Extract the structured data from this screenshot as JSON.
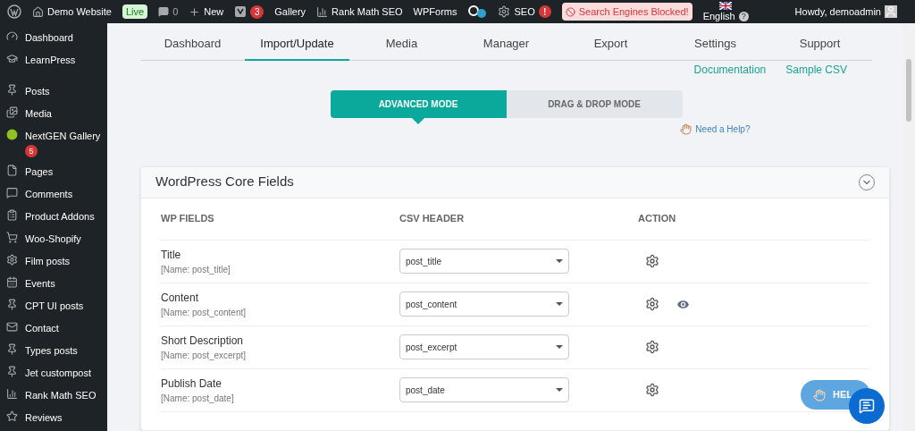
{
  "admin_bar": {
    "site": "Demo Website",
    "live": "Live",
    "comments": "0",
    "new": "New",
    "yoast_count": "3",
    "gallery": "Gallery",
    "rank_math": "Rank Math SEO",
    "wpforms": "WPForms",
    "seo": "SEO",
    "seo_alert": "!",
    "blocked": "Search Engines Blocked!",
    "language": "English",
    "language_help": "?",
    "greeting": "Howdy, demoadmin"
  },
  "sidebar": {
    "items": [
      {
        "label": "Dashboard"
      },
      {
        "label": "LearnPress"
      },
      {
        "label": "Posts"
      },
      {
        "label": "Media"
      },
      {
        "label": "NextGEN Gallery",
        "badge": "5"
      },
      {
        "label": "Pages"
      },
      {
        "label": "Comments"
      },
      {
        "label": "Product Addons"
      },
      {
        "label": "Woo-Shopify"
      },
      {
        "label": "Film posts"
      },
      {
        "label": "Events"
      },
      {
        "label": "CPT UI posts"
      },
      {
        "label": "Contact"
      },
      {
        "label": "Types posts"
      },
      {
        "label": "Jet custompost"
      },
      {
        "label": "Rank Math SEO"
      },
      {
        "label": "Reviews"
      }
    ]
  },
  "tabs": [
    {
      "label": "Dashboard",
      "selected": false
    },
    {
      "label": "Import/Update",
      "selected": true
    },
    {
      "label": "Media",
      "selected": false
    },
    {
      "label": "Manager",
      "selected": false
    },
    {
      "label": "Export",
      "selected": false
    },
    {
      "label": "Settings",
      "selected": false
    },
    {
      "label": "Support",
      "selected": false
    }
  ],
  "links": [
    "Documentation",
    "Sample CSV"
  ],
  "modes": [
    {
      "label": "ADVANCED MODE",
      "selected": true
    },
    {
      "label": "DRAG & DROP MODE",
      "selected": false
    }
  ],
  "help_link": "Need a Help?",
  "card": {
    "title": "WordPress Core Fields",
    "expanded": true,
    "columns": [
      "WP FIELDS",
      "CSV HEADER",
      "ACTION"
    ],
    "rows": [
      {
        "label": "Title",
        "name": "[Name: post_title]",
        "value": "post_title",
        "preview": false
      },
      {
        "label": "Content",
        "name": "[Name: post_content]",
        "value": "post_content",
        "preview": true
      },
      {
        "label": "Short Description",
        "name": "[Name: post_excerpt]",
        "value": "post_excerpt",
        "preview": false
      },
      {
        "label": "Publish Date",
        "name": "[Name: post_date]",
        "value": "post_date",
        "preview": false
      }
    ]
  },
  "help_button": "HEL"
}
